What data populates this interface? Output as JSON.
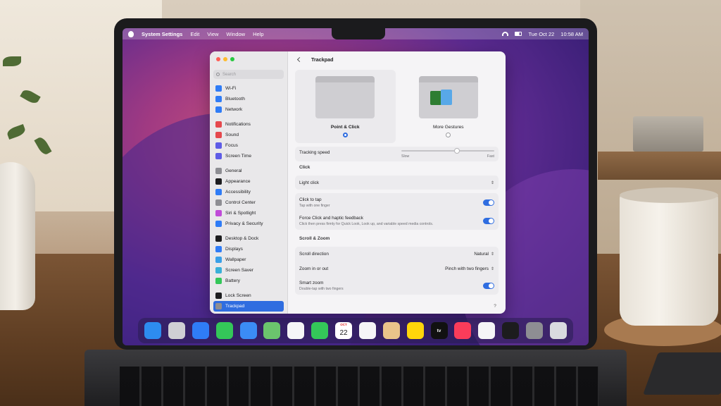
{
  "menubar": {
    "app_name": "System Settings",
    "menus": [
      "Edit",
      "View",
      "Window",
      "Help"
    ],
    "date": "Tue Oct 22",
    "time": "10:58 AM"
  },
  "window": {
    "title": "Trackpad",
    "search_placeholder": "Search"
  },
  "sidebar": {
    "groups": [
      [
        {
          "label": "Wi-Fi",
          "icon": "wifi-icon",
          "color": "#2f7cf6"
        },
        {
          "label": "Bluetooth",
          "icon": "bluetooth-icon",
          "color": "#2f7cf6"
        },
        {
          "label": "Network",
          "icon": "network-icon",
          "color": "#2f7cf6"
        }
      ],
      [
        {
          "label": "Notifications",
          "icon": "notifications-icon",
          "color": "#e5484d"
        },
        {
          "label": "Sound",
          "icon": "sound-icon",
          "color": "#e5484d"
        },
        {
          "label": "Focus",
          "icon": "focus-icon",
          "color": "#5e5ce6"
        },
        {
          "label": "Screen Time",
          "icon": "screen-time-icon",
          "color": "#5e5ce6"
        }
      ],
      [
        {
          "label": "General",
          "icon": "general-icon",
          "color": "#8e8e93"
        },
        {
          "label": "Appearance",
          "icon": "appearance-icon",
          "color": "#1d1d1f"
        },
        {
          "label": "Accessibility",
          "icon": "accessibility-icon",
          "color": "#2f7cf6"
        },
        {
          "label": "Control Center",
          "icon": "control-center-icon",
          "color": "#8e8e93"
        },
        {
          "label": "Siri & Spotlight",
          "icon": "siri-icon",
          "color": "#c04bd8"
        },
        {
          "label": "Privacy & Security",
          "icon": "privacy-icon",
          "color": "#2f7cf6"
        }
      ],
      [
        {
          "label": "Desktop & Dock",
          "icon": "desktop-dock-icon",
          "color": "#1d1d1f"
        },
        {
          "label": "Displays",
          "icon": "displays-icon",
          "color": "#2f7cf6"
        },
        {
          "label": "Wallpaper",
          "icon": "wallpaper-icon",
          "color": "#3aa0e8"
        },
        {
          "label": "Screen Saver",
          "icon": "screen-saver-icon",
          "color": "#3ab0d8"
        },
        {
          "label": "Battery",
          "icon": "battery-icon",
          "color": "#34c759"
        }
      ],
      [
        {
          "label": "Lock Screen",
          "icon": "lock-screen-icon",
          "color": "#1d1d1f"
        },
        {
          "label": "Trackpad",
          "icon": "trackpad-icon",
          "color": "#8e8e93",
          "active": true
        }
      ]
    ]
  },
  "main": {
    "modes": [
      {
        "label": "Point & Click",
        "selected": true
      },
      {
        "label": "More Gestures",
        "selected": false
      }
    ],
    "tracking": {
      "label": "Tracking speed",
      "min_label": "Slow",
      "max_label": "Fast",
      "value": 0.6
    },
    "click_section": "Click",
    "click_value": "Light click",
    "click_to_tap": {
      "label": "Click to tap",
      "sub": "Tap with one finger",
      "on": true
    },
    "force_click": {
      "label": "Force Click and haptic feedback",
      "sub": "Click then press firmly for Quick Look, Look up, and variable speed media controls.",
      "on": true
    },
    "scroll_section": "Scroll & Zoom",
    "scroll_direction": {
      "label": "Scroll direction",
      "value": "Natural"
    },
    "zoom": {
      "label": "Zoom in or out",
      "value": "Pinch with two fingers"
    },
    "smart_zoom": {
      "label": "Smart zoom",
      "sub": "Double-tap with two fingers",
      "on": true
    },
    "help": "?"
  },
  "dock": {
    "apps": [
      {
        "name": "finder-icon",
        "color": "#2d8cf0"
      },
      {
        "name": "launchpad-icon",
        "color": "#cfcfd4"
      },
      {
        "name": "safari-icon",
        "color": "#2f7cf6"
      },
      {
        "name": "messages-icon",
        "color": "#34c759"
      },
      {
        "name": "mail-icon",
        "color": "#3b8cf5"
      },
      {
        "name": "maps-icon",
        "color": "#6bc46d"
      },
      {
        "name": "photos-icon",
        "color": "#f5f5f7"
      },
      {
        "name": "facetime-icon",
        "color": "#34c759"
      },
      {
        "name": "calendar-icon",
        "color": "#ffffff",
        "month": "OCT",
        "day": "22"
      },
      {
        "name": "reminders-icon",
        "color": "#f5f5f7"
      },
      {
        "name": "contacts-icon",
        "color": "#e9c48a"
      },
      {
        "name": "notes-icon",
        "color": "#ffd60a"
      },
      {
        "name": "tv-icon",
        "color": "#111111",
        "text": "tv"
      },
      {
        "name": "music-icon",
        "color": "#fa3c5a"
      },
      {
        "name": "news-icon",
        "color": "#f5f5f7"
      },
      {
        "name": "stocks-icon",
        "color": "#1c1c1e"
      },
      {
        "name": "system-settings-icon",
        "color": "#8e8e93"
      },
      {
        "name": "trash-icon",
        "color": "#d9dadf"
      }
    ]
  }
}
